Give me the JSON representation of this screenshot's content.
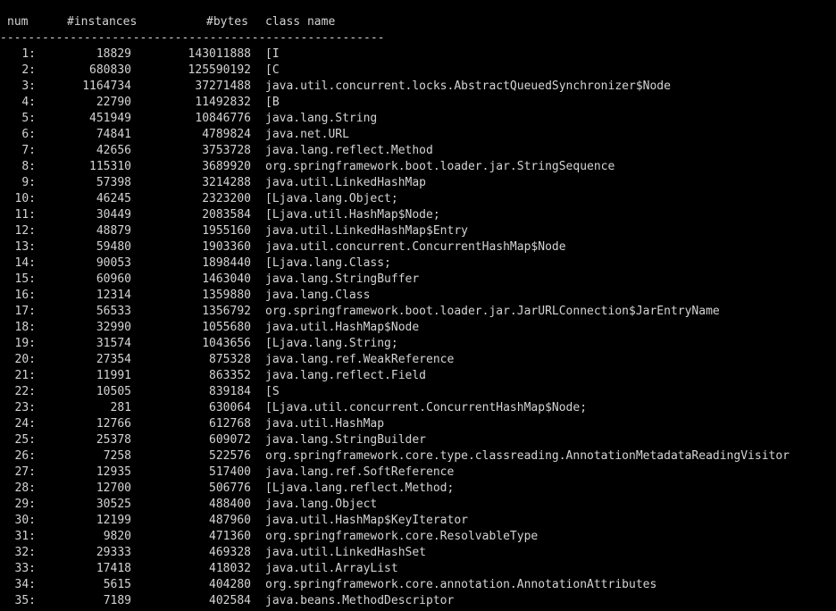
{
  "header": {
    "num": "num",
    "instances": "#instances",
    "bytes": "#bytes",
    "class_name": "class name"
  },
  "separator": "-------------------------------------------------------",
  "rows": [
    {
      "num": "1:",
      "instances": "18829",
      "bytes": "143011888",
      "class_name": "[I"
    },
    {
      "num": "2:",
      "instances": "680830",
      "bytes": "125590192",
      "class_name": "[C"
    },
    {
      "num": "3:",
      "instances": "1164734",
      "bytes": "37271488",
      "class_name": "java.util.concurrent.locks.AbstractQueuedSynchronizer$Node"
    },
    {
      "num": "4:",
      "instances": "22790",
      "bytes": "11492832",
      "class_name": "[B"
    },
    {
      "num": "5:",
      "instances": "451949",
      "bytes": "10846776",
      "class_name": "java.lang.String"
    },
    {
      "num": "6:",
      "instances": "74841",
      "bytes": "4789824",
      "class_name": "java.net.URL"
    },
    {
      "num": "7:",
      "instances": "42656",
      "bytes": "3753728",
      "class_name": "java.lang.reflect.Method"
    },
    {
      "num": "8:",
      "instances": "115310",
      "bytes": "3689920",
      "class_name": "org.springframework.boot.loader.jar.StringSequence"
    },
    {
      "num": "9:",
      "instances": "57398",
      "bytes": "3214288",
      "class_name": "java.util.LinkedHashMap"
    },
    {
      "num": "10:",
      "instances": "46245",
      "bytes": "2323200",
      "class_name": "[Ljava.lang.Object;"
    },
    {
      "num": "11:",
      "instances": "30449",
      "bytes": "2083584",
      "class_name": "[Ljava.util.HashMap$Node;"
    },
    {
      "num": "12:",
      "instances": "48879",
      "bytes": "1955160",
      "class_name": "java.util.LinkedHashMap$Entry"
    },
    {
      "num": "13:",
      "instances": "59480",
      "bytes": "1903360",
      "class_name": "java.util.concurrent.ConcurrentHashMap$Node"
    },
    {
      "num": "14:",
      "instances": "90053",
      "bytes": "1898440",
      "class_name": "[Ljava.lang.Class;"
    },
    {
      "num": "15:",
      "instances": "60960",
      "bytes": "1463040",
      "class_name": "java.lang.StringBuffer"
    },
    {
      "num": "16:",
      "instances": "12314",
      "bytes": "1359880",
      "class_name": "java.lang.Class"
    },
    {
      "num": "17:",
      "instances": "56533",
      "bytes": "1356792",
      "class_name": "org.springframework.boot.loader.jar.JarURLConnection$JarEntryName"
    },
    {
      "num": "18:",
      "instances": "32990",
      "bytes": "1055680",
      "class_name": "java.util.HashMap$Node"
    },
    {
      "num": "19:",
      "instances": "31574",
      "bytes": "1043656",
      "class_name": "[Ljava.lang.String;"
    },
    {
      "num": "20:",
      "instances": "27354",
      "bytes": "875328",
      "class_name": "java.lang.ref.WeakReference"
    },
    {
      "num": "21:",
      "instances": "11991",
      "bytes": "863352",
      "class_name": "java.lang.reflect.Field"
    },
    {
      "num": "22:",
      "instances": "10505",
      "bytes": "839184",
      "class_name": "[S"
    },
    {
      "num": "23:",
      "instances": "281",
      "bytes": "630064",
      "class_name": "[Ljava.util.concurrent.ConcurrentHashMap$Node;"
    },
    {
      "num": "24:",
      "instances": "12766",
      "bytes": "612768",
      "class_name": "java.util.HashMap"
    },
    {
      "num": "25:",
      "instances": "25378",
      "bytes": "609072",
      "class_name": "java.lang.StringBuilder"
    },
    {
      "num": "26:",
      "instances": "7258",
      "bytes": "522576",
      "class_name": "org.springframework.core.type.classreading.AnnotationMetadataReadingVisitor"
    },
    {
      "num": "27:",
      "instances": "12935",
      "bytes": "517400",
      "class_name": "java.lang.ref.SoftReference"
    },
    {
      "num": "28:",
      "instances": "12700",
      "bytes": "506776",
      "class_name": "[Ljava.lang.reflect.Method;"
    },
    {
      "num": "29:",
      "instances": "30525",
      "bytes": "488400",
      "class_name": "java.lang.Object"
    },
    {
      "num": "30:",
      "instances": "12199",
      "bytes": "487960",
      "class_name": "java.util.HashMap$KeyIterator"
    },
    {
      "num": "31:",
      "instances": "9820",
      "bytes": "471360",
      "class_name": "org.springframework.core.ResolvableType"
    },
    {
      "num": "32:",
      "instances": "29333",
      "bytes": "469328",
      "class_name": "java.util.LinkedHashSet"
    },
    {
      "num": "33:",
      "instances": "17418",
      "bytes": "418032",
      "class_name": "java.util.ArrayList"
    },
    {
      "num": "34:",
      "instances": "5615",
      "bytes": "404280",
      "class_name": "org.springframework.core.annotation.AnnotationAttributes"
    },
    {
      "num": "35:",
      "instances": "7189",
      "bytes": "402584",
      "class_name": "java.beans.MethodDescriptor"
    }
  ],
  "colors": {
    "background": "#000000",
    "text": "#d4d4d4"
  }
}
